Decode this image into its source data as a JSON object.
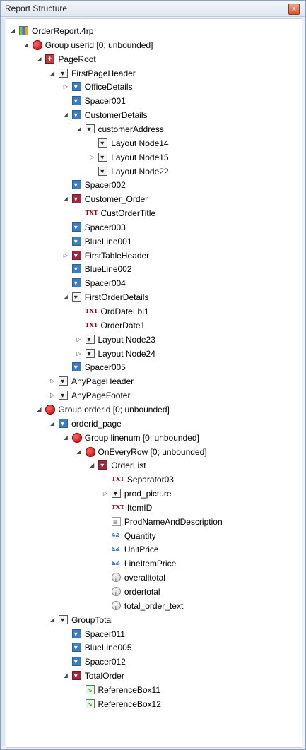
{
  "panel": {
    "title": "Report Structure",
    "close_label": "x"
  },
  "tree": [
    {
      "label": "OrderReport.4rp",
      "depth": 0,
      "icon": "report-icon",
      "expander": "expanded"
    },
    {
      "label": "Group userid [0; unbounded]",
      "depth": 1,
      "icon": "group-icon",
      "expander": "expanded"
    },
    {
      "label": "PageRoot",
      "depth": 2,
      "icon": "page-root-icon",
      "expander": "expanded"
    },
    {
      "label": "FirstPageHeader",
      "depth": 3,
      "icon": "container-icon",
      "expander": "expanded"
    },
    {
      "label": "OfficeDetails",
      "depth": 4,
      "icon": "blue-container-icon",
      "expander": "collapsed"
    },
    {
      "label": "Spacer001",
      "depth": 4,
      "icon": "blue-container-icon",
      "expander": "none"
    },
    {
      "label": "CustomerDetails",
      "depth": 4,
      "icon": "blue-container-icon",
      "expander": "expanded"
    },
    {
      "label": "customerAddress",
      "depth": 5,
      "icon": "container-icon",
      "expander": "expanded"
    },
    {
      "label": "Layout Node14",
      "depth": 6,
      "icon": "container-icon",
      "expander": "none"
    },
    {
      "label": "Layout Node15",
      "depth": 6,
      "icon": "container-icon",
      "expander": "collapsed"
    },
    {
      "label": "Layout Node22",
      "depth": 6,
      "icon": "container-icon",
      "expander": "none"
    },
    {
      "label": "Spacer002",
      "depth": 4,
      "icon": "blue-container-icon",
      "expander": "none"
    },
    {
      "label": "Customer_Order",
      "depth": 4,
      "icon": "red-container-icon",
      "expander": "expanded"
    },
    {
      "label": "CustOrderTitle",
      "depth": 5,
      "icon": "text-icon",
      "expander": "none"
    },
    {
      "label": "Spacer003",
      "depth": 4,
      "icon": "blue-container-icon",
      "expander": "none"
    },
    {
      "label": "BlueLine001",
      "depth": 4,
      "icon": "blue-container-icon",
      "expander": "none"
    },
    {
      "label": "FirstTableHeader",
      "depth": 4,
      "icon": "red-container-icon",
      "expander": "collapsed"
    },
    {
      "label": "BlueLine002",
      "depth": 4,
      "icon": "blue-container-icon",
      "expander": "none"
    },
    {
      "label": "Spacer004",
      "depth": 4,
      "icon": "blue-container-icon",
      "expander": "none"
    },
    {
      "label": "FirstOrderDetails",
      "depth": 4,
      "icon": "container-icon",
      "expander": "expanded"
    },
    {
      "label": "OrdDateLbl1",
      "depth": 5,
      "icon": "text-icon",
      "expander": "none"
    },
    {
      "label": "OrderDate1",
      "depth": 5,
      "icon": "text-icon",
      "expander": "none"
    },
    {
      "label": "Layout Node23",
      "depth": 5,
      "icon": "container-icon",
      "expander": "collapsed"
    },
    {
      "label": "Layout Node24",
      "depth": 5,
      "icon": "container-icon",
      "expander": "collapsed"
    },
    {
      "label": "Spacer005",
      "depth": 4,
      "icon": "blue-container-icon",
      "expander": "none"
    },
    {
      "label": "AnyPageHeader",
      "depth": 3,
      "icon": "container-icon",
      "expander": "collapsed"
    },
    {
      "label": "AnyPageFooter",
      "depth": 3,
      "icon": "container-icon",
      "expander": "collapsed"
    },
    {
      "label": "Group orderid [0; unbounded]",
      "depth": 2,
      "icon": "group-icon",
      "expander": "expanded"
    },
    {
      "label": "orderid_page",
      "depth": 3,
      "icon": "blue-container-icon",
      "expander": "expanded"
    },
    {
      "label": "Group linenum [0; unbounded]",
      "depth": 4,
      "icon": "group-icon",
      "expander": "expanded"
    },
    {
      "label": "OnEveryRow [0; unbounded]",
      "depth": 5,
      "icon": "group-icon",
      "expander": "expanded"
    },
    {
      "label": "OrderList",
      "depth": 6,
      "icon": "red-container-icon",
      "expander": "expanded"
    },
    {
      "label": "Separator03",
      "depth": 7,
      "icon": "text-icon",
      "expander": "none"
    },
    {
      "label": "prod_picture",
      "depth": 7,
      "icon": "container-icon",
      "expander": "collapsed"
    },
    {
      "label": "ItemID",
      "depth": 7,
      "icon": "text-icon",
      "expander": "none"
    },
    {
      "label": "ProdNameAndDescription",
      "depth": 7,
      "icon": "description-icon",
      "expander": "none"
    },
    {
      "label": "Quantity",
      "depth": 7,
      "icon": "field-icon",
      "expander": "none"
    },
    {
      "label": "UnitPrice",
      "depth": 7,
      "icon": "field-icon",
      "expander": "none"
    },
    {
      "label": "LineItemPrice",
      "depth": 7,
      "icon": "field-icon",
      "expander": "none"
    },
    {
      "label": "overalltotal",
      "depth": 7,
      "icon": "calc-icon",
      "expander": "none"
    },
    {
      "label": "ordertotal",
      "depth": 7,
      "icon": "calc-icon",
      "expander": "none"
    },
    {
      "label": "total_order_text",
      "depth": 7,
      "icon": "calc-icon",
      "expander": "none"
    },
    {
      "label": "GroupTotal",
      "depth": 3,
      "icon": "container-icon",
      "expander": "expanded"
    },
    {
      "label": "Spacer011",
      "depth": 4,
      "icon": "blue-container-icon",
      "expander": "none"
    },
    {
      "label": "BlueLine005",
      "depth": 4,
      "icon": "blue-container-icon",
      "expander": "none"
    },
    {
      "label": "Spacer012",
      "depth": 4,
      "icon": "blue-container-icon",
      "expander": "none"
    },
    {
      "label": "TotalOrder",
      "depth": 4,
      "icon": "red-container-icon",
      "expander": "expanded"
    },
    {
      "label": "ReferenceBox11",
      "depth": 5,
      "icon": "reference-icon",
      "expander": "none"
    },
    {
      "label": "ReferenceBox12",
      "depth": 5,
      "icon": "reference-icon",
      "expander": "none"
    }
  ]
}
